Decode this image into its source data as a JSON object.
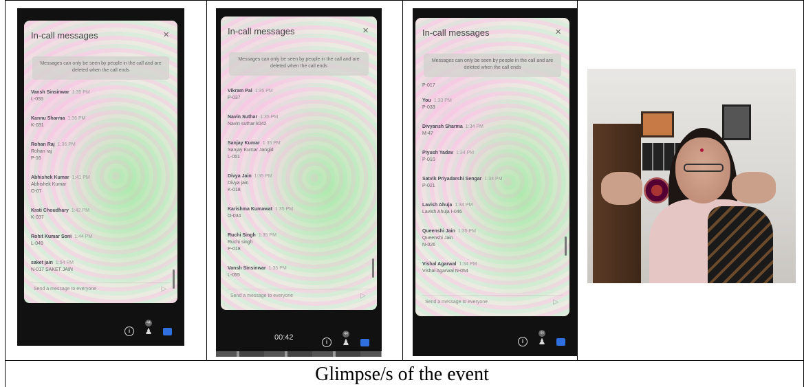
{
  "caption": "Glimpse/s of the event",
  "screens": [
    {
      "title": "In-call messages",
      "close": "×",
      "notice": "Messages can only be seen by people in the call and are deleted when the call ends",
      "messages": [
        {
          "name": "Vansh Sinsinwar",
          "time": "1:35 PM",
          "lines": [
            "L-055"
          ]
        },
        {
          "name": "Kannu Sharma",
          "time": "1:36 PM",
          "lines": [
            "K-031"
          ]
        },
        {
          "name": "Rohan Raj",
          "time": "1:36 PM",
          "lines": [
            "Rohan raj",
            "P-16"
          ]
        },
        {
          "name": "Abhishek Kumar",
          "time": "1:41 PM",
          "lines": [
            "Abhishek Kumar",
            "O-07"
          ]
        },
        {
          "name": "Krati Choudhary",
          "time": "1:42 PM",
          "lines": [
            "K-037"
          ]
        },
        {
          "name": "Rohit Kumar Soni",
          "time": "1:44 PM",
          "lines": [
            "L-049"
          ]
        },
        {
          "name": "saket jain",
          "time": "1:54 PM",
          "lines": [
            "N-017 SAKET JAIN"
          ]
        }
      ],
      "send_placeholder": "Send a message to everyone",
      "badge": "44",
      "timer": ""
    },
    {
      "title": "In-call messages",
      "close": "×",
      "notice": "Messages can only be seen by people in the call and are deleted when the call ends",
      "messages": [
        {
          "name": "Vikram Pal",
          "time": "1:35 PM",
          "lines": [
            "P-037"
          ]
        },
        {
          "name": "Navin Suthar",
          "time": "1:35 PM",
          "lines": [
            "Navin suthar k042"
          ]
        },
        {
          "name": "Sanjay Kumar",
          "time": "1:35 PM",
          "lines": [
            "Sanjay Kumar Jangid",
            "L-051"
          ]
        },
        {
          "name": "Divya Jain",
          "time": "1:35 PM",
          "lines": [
            "Divya jain",
            "K-018"
          ]
        },
        {
          "name": "Karishma Kumawat",
          "time": "1:35 PM",
          "lines": [
            "O-034"
          ]
        },
        {
          "name": "Ruchi Singh",
          "time": "1:35 PM",
          "lines": [
            "Ruchi singh",
            "P-018"
          ]
        },
        {
          "name": "Vansh Sinsinwar",
          "time": "1:35 PM",
          "lines": [
            "L-055"
          ]
        }
      ],
      "send_placeholder": "Send a message to everyone",
      "badge": "44",
      "timer": "00:42"
    },
    {
      "title": "In-call messages",
      "close": "×",
      "notice": "Messages can only be seen by people in the call and are deleted when the call ends",
      "top_fragment": "P-017",
      "messages": [
        {
          "name": "You",
          "time": "1:33 PM",
          "lines": [
            "P-033"
          ]
        },
        {
          "name": "Divyansh Sharma",
          "time": "1:34 PM",
          "lines": [
            "M-47"
          ]
        },
        {
          "name": "Piyush Yadav",
          "time": "1:34 PM",
          "lines": [
            "P-010"
          ]
        },
        {
          "name": "Satvik Priyadarshi Sengar",
          "time": "1:34 PM",
          "lines": [
            "P-021"
          ]
        },
        {
          "name": "Lavish Ahuja",
          "time": "1:34 PM",
          "lines": [
            "Lavish Ahuja I-046"
          ]
        },
        {
          "name": "Queenshi Jain",
          "time": "1:35 PM",
          "lines": [
            "Queenshi Jain",
            "N-026"
          ]
        },
        {
          "name": "Vishal Agarwal",
          "time": "1:34 PM",
          "lines": [
            "Vishal Agarwal N-054"
          ]
        }
      ],
      "send_placeholder": "Send a message to everyone",
      "badge": "44",
      "timer": ""
    }
  ],
  "icons": {
    "info": "info-icon",
    "people": "people-icon",
    "chat": "chat-icon",
    "send": "send-icon"
  }
}
